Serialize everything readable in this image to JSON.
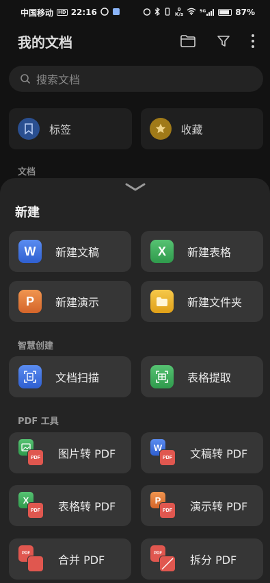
{
  "status_bar": {
    "carrier": "中国移动",
    "hd": "HD",
    "time": "22:16",
    "net_speed_value": "0",
    "net_speed_unit": "K/s",
    "signal_type": "5G",
    "battery": "87%"
  },
  "header": {
    "title": "我的文档"
  },
  "search": {
    "placeholder": "搜索文档"
  },
  "quick": [
    {
      "label": "标签",
      "icon": "bookmark-icon",
      "color": "#2a5aa8"
    },
    {
      "label": "收藏",
      "icon": "star-icon",
      "color": "#b38a1c"
    }
  ],
  "doc_section": "文档",
  "sheet": {
    "title": "新建",
    "new_items": [
      {
        "label": "新建文稿",
        "icon": "word-icon",
        "glyph": "W",
        "color": "#3a6fe0"
      },
      {
        "label": "新建表格",
        "icon": "excel-icon",
        "glyph": "X",
        "color": "#3aa85a"
      },
      {
        "label": "新建演示",
        "icon": "ppt-icon",
        "glyph": "P",
        "color": "#e07a38"
      },
      {
        "label": "新建文件夹",
        "icon": "folder-icon",
        "glyph": "",
        "color": "#e8b020"
      }
    ],
    "smart_title": "智慧创建",
    "smart_items": [
      {
        "label": "文档扫描",
        "icon": "scan-icon",
        "color": "#3a6fe0"
      },
      {
        "label": "表格提取",
        "icon": "table-extract-icon",
        "color": "#3aa85a"
      }
    ],
    "pdf_title": "PDF 工具",
    "pdf_items": [
      {
        "label": "图片转 PDF",
        "icon": "image-to-pdf-icon",
        "glyph": "",
        "color": "#3aa85a"
      },
      {
        "label": "文稿转 PDF",
        "icon": "word-to-pdf-icon",
        "glyph": "W",
        "color": "#3a6fe0"
      },
      {
        "label": "表格转 PDF",
        "icon": "excel-to-pdf-icon",
        "glyph": "X",
        "color": "#3aa85a"
      },
      {
        "label": "演示转 PDF",
        "icon": "ppt-to-pdf-icon",
        "glyph": "P",
        "color": "#e07a38"
      },
      {
        "label": "合并 PDF",
        "icon": "merge-pdf-icon",
        "glyph": "",
        "color": "#e0574f"
      },
      {
        "label": "拆分 PDF",
        "icon": "split-pdf-icon",
        "glyph": "",
        "color": "#e0574f"
      }
    ],
    "pdf_badge": "PDF"
  }
}
